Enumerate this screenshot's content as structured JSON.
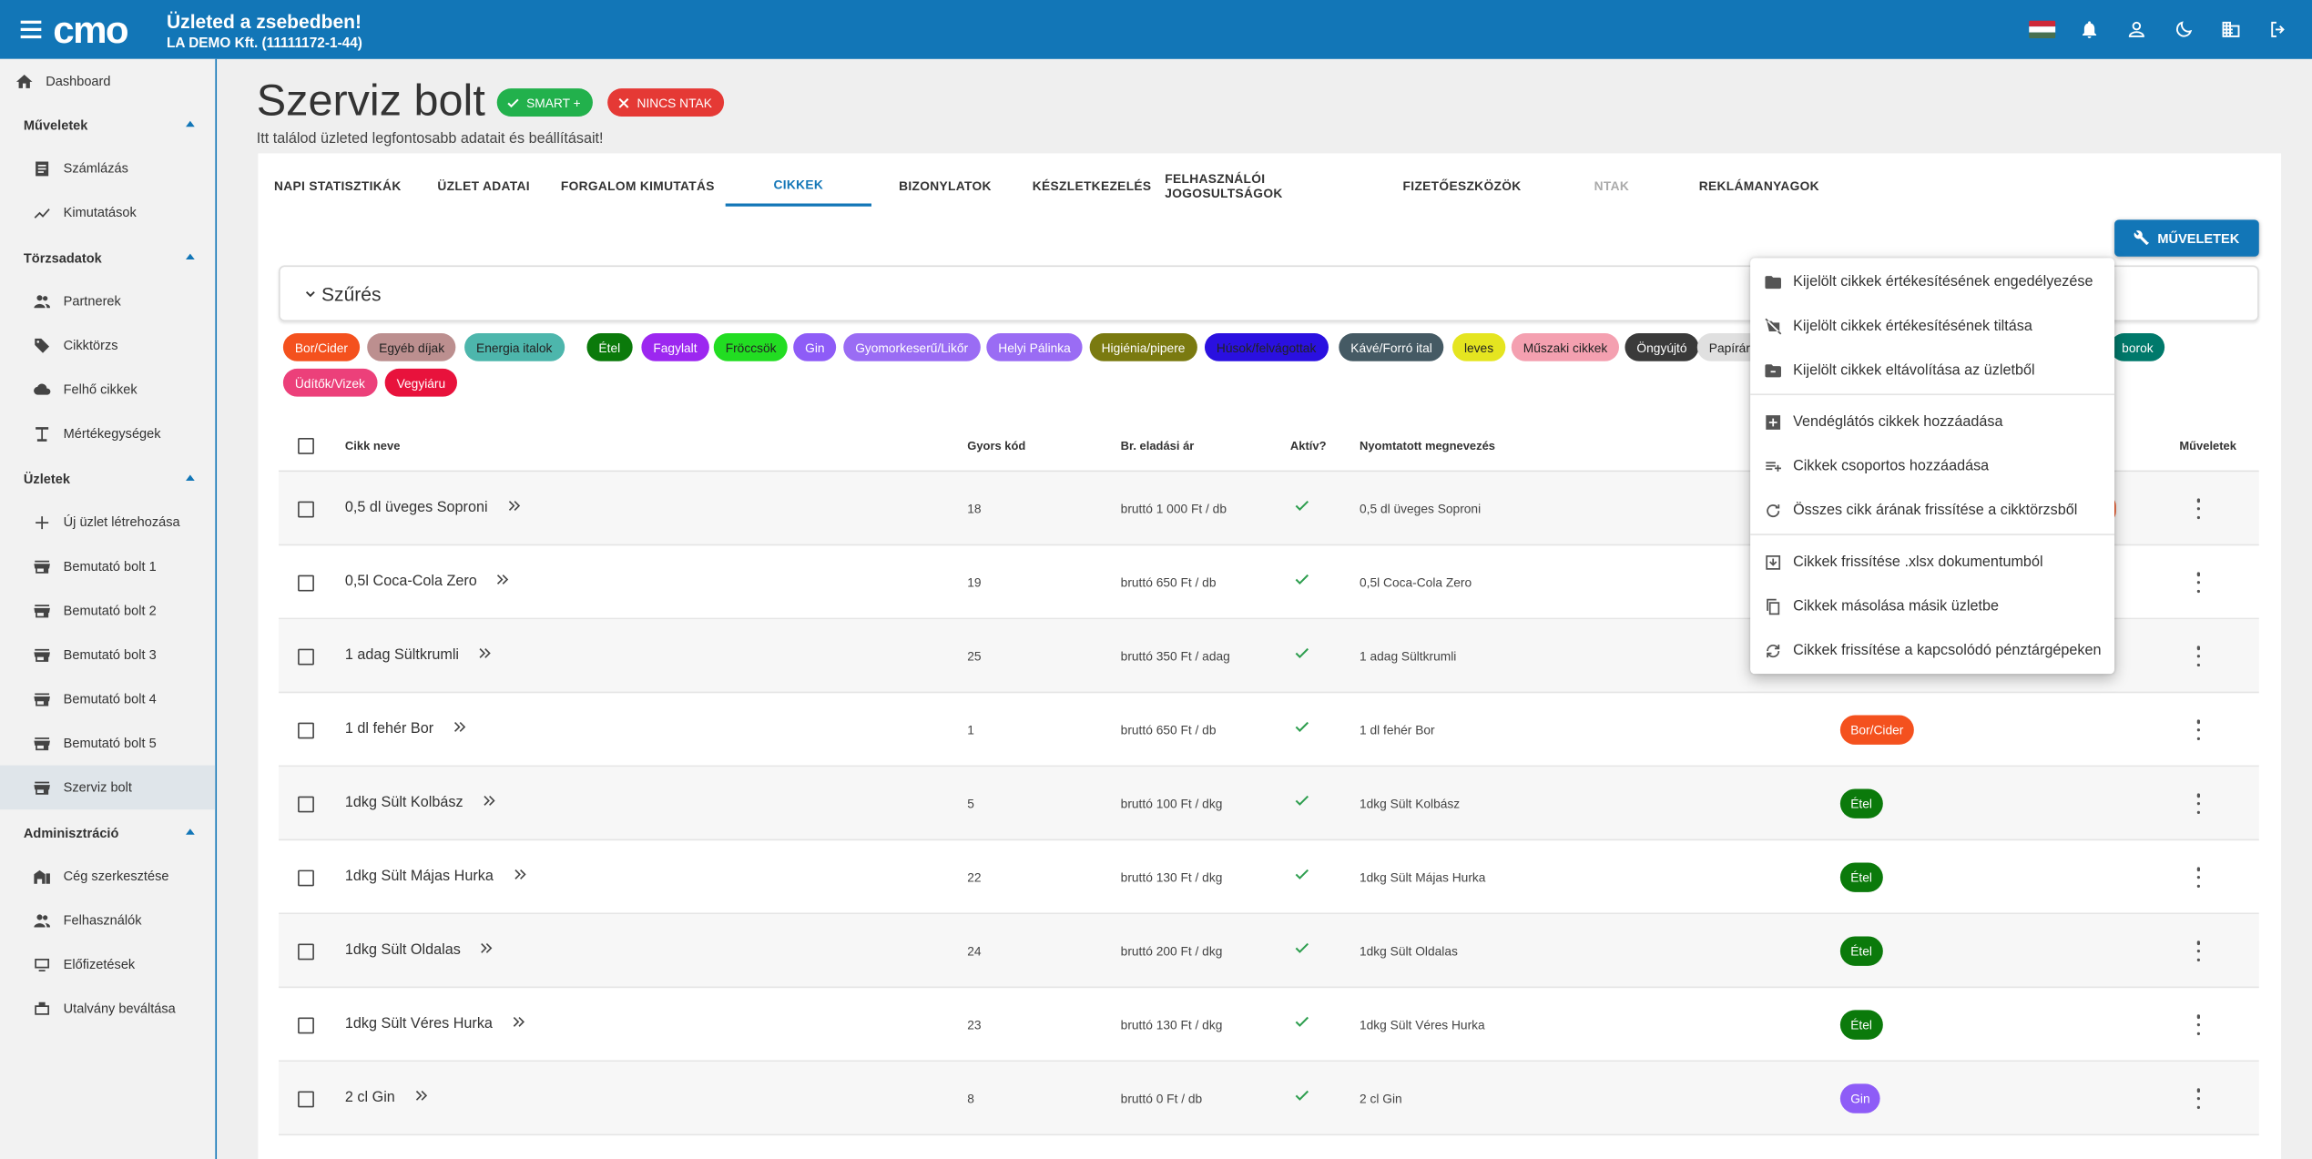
{
  "topbar": {
    "title": "Üzleted a zsebedben!",
    "company": "LA DEMO Kft. (11111172-1-44)",
    "logo": "cmo"
  },
  "sidebar": {
    "dashboard": "Dashboard",
    "sections": [
      {
        "label": "Műveletek",
        "items": [
          {
            "label": "Számlázás",
            "icon": "receipt-icon"
          },
          {
            "label": "Kimutatások",
            "icon": "chart-line-icon"
          }
        ]
      },
      {
        "label": "Törzsadatok",
        "items": [
          {
            "label": "Partnerek",
            "icon": "people-icon"
          },
          {
            "label": "Cikktörzs",
            "icon": "tag-icon"
          },
          {
            "label": "Felhő cikkek",
            "icon": "cloud-icon"
          },
          {
            "label": "Mértékegységek",
            "icon": "scale-icon"
          }
        ]
      },
      {
        "label": "Üzletek",
        "items": [
          {
            "label": "Új üzlet létrehozása",
            "icon": "plus-icon"
          },
          {
            "label": "Bemutató bolt 1",
            "icon": "store-icon"
          },
          {
            "label": "Bemutató bolt 2",
            "icon": "store-icon"
          },
          {
            "label": "Bemutató bolt 3",
            "icon": "store-icon"
          },
          {
            "label": "Bemutató bolt 4",
            "icon": "store-icon"
          },
          {
            "label": "Bemutató bolt 5",
            "icon": "store-icon"
          },
          {
            "label": "Szerviz bolt",
            "icon": "store-icon",
            "active": true
          }
        ]
      },
      {
        "label": "Adminisztráció",
        "items": [
          {
            "label": "Cég szerkesztése",
            "icon": "company-icon"
          },
          {
            "label": "Felhasználók",
            "icon": "people-icon"
          },
          {
            "label": "Előfizetések",
            "icon": "subscription-icon"
          },
          {
            "label": "Utalvány beváltása",
            "icon": "voucher-icon"
          }
        ]
      }
    ]
  },
  "page": {
    "title": "Szerviz bolt",
    "subtitle": "Itt találod üzleted legfontosabb adatait és beállításait!",
    "badge_smart": "SMART +",
    "badge_ntak": "NINCS NTAK"
  },
  "tabs": [
    "NAPI STATISZTIKÁK",
    "ÜZLET ADATAI",
    "FORGALOM KIMUTATÁS",
    "CIKKEK",
    "BIZONYLATOK",
    "KÉSZLETKEZELÉS",
    "FELHASZNÁLÓI JOGOSULTSÁGOK",
    "FIZETŐESZKÖZÖK",
    "NTAK",
    "REKLÁMANYAGOK"
  ],
  "ops_button": "MŰVELETEK",
  "filter": {
    "title": "Szűrés"
  },
  "chips": [
    {
      "label": "Bor/Cider",
      "bg": "#f4511e",
      "fg": "#ffffff"
    },
    {
      "label": "Egyéb díjak",
      "bg": "#bc8f8f",
      "fg": "#222222"
    },
    {
      "label": "Energia italok",
      "bg": "#4db6ac",
      "fg": "#222222"
    },
    {
      "label": "Étel",
      "bg": "#0b7a0b",
      "fg": "#ffffff"
    },
    {
      "label": "Fagylalt",
      "bg": "#9c27f0",
      "fg": "#ffffff"
    },
    {
      "label": "Fröccsök",
      "bg": "#22dd22",
      "fg": "#222222"
    },
    {
      "label": "Gin",
      "bg": "#8e5cf7",
      "fg": "#ffffff"
    },
    {
      "label": "Gyomorkeserű/Likőr",
      "bg": "#9a6cf4",
      "fg": "#ffffff"
    },
    {
      "label": "Helyi Pálinka",
      "bg": "#9a6cf4",
      "fg": "#ffffff"
    },
    {
      "label": "Higiénia/pipere",
      "bg": "#7a7a10",
      "fg": "#ffffff"
    },
    {
      "label": "Húsok/felvágottak",
      "bg": "#2a10e0",
      "fg": "#222222"
    },
    {
      "label": "Kávé/Forró ital",
      "bg": "#455a64",
      "fg": "#ffffff"
    },
    {
      "label": "leves",
      "bg": "#e5e520",
      "fg": "#222222"
    },
    {
      "label": "Műszaki cikkek",
      "bg": "#f4a0b0",
      "fg": "#222222"
    },
    {
      "label": "Öngyújtó",
      "bg": "#3a3a3a",
      "fg": "#ffffff"
    },
    {
      "label": "Papíráru",
      "bg": "#e0e0e0",
      "fg": "#222222"
    },
    {
      "label": "borok",
      "bg": "#00796b",
      "fg": "#ffffff"
    },
    {
      "label": "Üdítők/Vizek",
      "bg": "#ec407a",
      "fg": "#ffffff"
    },
    {
      "label": "Vegyiáru",
      "bg": "#e8123c",
      "fg": "#ffffff"
    }
  ],
  "table": {
    "headers": [
      "Cikk neve",
      "Gyors kód",
      "Br. eladási ár",
      "Aktív?",
      "Nyomtatott megnevezés",
      "Műveletek"
    ],
    "rows": [
      {
        "name": "0,5 dl üveges Soproni",
        "code": "18",
        "price": "bruttó 1 000 Ft / db",
        "printed": "0,5 dl üveges Soproni",
        "category": "",
        "cat_color": "#f4511e"
      },
      {
        "name": "0,5l Coca-Cola Zero",
        "code": "19",
        "price": "bruttó 650 Ft / db",
        "printed": "0,5l Coca-Cola Zero",
        "category": "",
        "cat_color": ""
      },
      {
        "name": "1 adag Sültkrumli",
        "code": "25",
        "price": "bruttó 350 Ft / adag",
        "printed": "1 adag Sültkrumli",
        "category": "",
        "cat_color": ""
      },
      {
        "name": "1 dl fehér Bor",
        "code": "1",
        "price": "bruttó 650 Ft / db",
        "printed": "1 dl fehér Bor",
        "category": "Bor/Cider",
        "cat_color": "#f4511e"
      },
      {
        "name": "1dkg Sült Kolbász",
        "code": "5",
        "price": "bruttó 100 Ft / dkg",
        "printed": "1dkg Sült Kolbász",
        "category": "Étel",
        "cat_color": "#0b7a0b"
      },
      {
        "name": "1dkg Sült Májas Hurka",
        "code": "22",
        "price": "bruttó 130 Ft / dkg",
        "printed": "1dkg Sült Májas Hurka",
        "category": "Étel",
        "cat_color": "#0b7a0b"
      },
      {
        "name": "1dkg Sült Oldalas",
        "code": "24",
        "price": "bruttó 200 Ft / dkg",
        "printed": "1dkg Sült Oldalas",
        "category": "Étel",
        "cat_color": "#0b7a0b"
      },
      {
        "name": "1dkg Sült Véres Hurka",
        "code": "23",
        "price": "bruttó 130 Ft / dkg",
        "printed": "1dkg Sült Véres Hurka",
        "category": "Étel",
        "cat_color": "#0b7a0b"
      },
      {
        "name": "2 cl Gin",
        "code": "8",
        "price": "bruttó 0 Ft / db",
        "printed": "2 cl Gin",
        "category": "Gin",
        "cat_color": "#8e5cf7"
      }
    ]
  },
  "menu": [
    {
      "label": "Kijelölt cikkek értékesítésének engedélyezése",
      "icon": "folder-icon"
    },
    {
      "label": "Kijelölt cikkek értékesítésének tiltása",
      "icon": "folder-off-icon"
    },
    {
      "label": "Kijelölt cikkek eltávolítása az üzletből",
      "icon": "folder-remove-icon"
    },
    {
      "label": "Vendéglátós cikkek hozzáadása",
      "icon": "add-box-icon"
    },
    {
      "label": "Cikkek csoportos hozzáadása",
      "icon": "playlist-add-icon"
    },
    {
      "label": "Összes cikk árának frissítése a cikktörzsből",
      "icon": "refresh-icon"
    },
    {
      "label": "Cikkek frissítése .xlsx dokumentumból",
      "icon": "download-icon"
    },
    {
      "label": "Cikkek másolása másik üzletbe",
      "icon": "copy-icon"
    },
    {
      "label": "Cikkek frissítése a kapcsolódó pénztárgépeken",
      "icon": "sync-icon"
    }
  ],
  "colors": {
    "primary": "#1276b7",
    "active_check": "#2e9e4f",
    "smart": "#22b14c",
    "ntak": "#e53935"
  }
}
